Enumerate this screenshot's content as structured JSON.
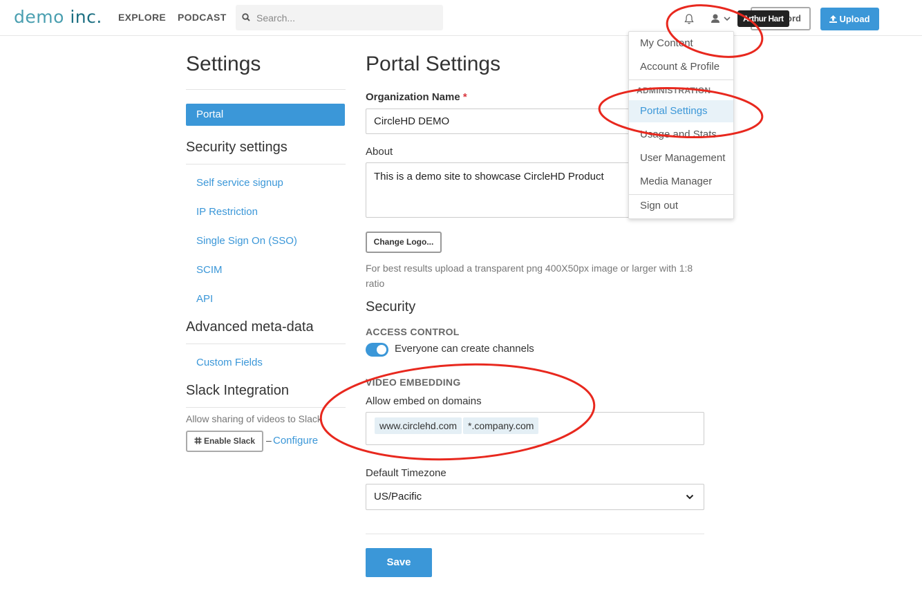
{
  "header": {
    "logo_main": "demo",
    "logo_accent": "inc.",
    "nav": [
      "EXPLORE",
      "PODCAST"
    ],
    "search_placeholder": "Search...",
    "user_tooltip": "Arthur Hart",
    "record_label": "ord",
    "upload_label": "Upload"
  },
  "sidebar": {
    "title": "Settings",
    "active_item": "Portal",
    "security_title": "Security settings",
    "security_links": [
      "Self service signup",
      "IP Restriction",
      "Single Sign On (SSO)",
      "SCIM",
      "API"
    ],
    "meta_title": "Advanced meta-data",
    "meta_links": [
      "Custom Fields"
    ],
    "slack_title": "Slack Integration",
    "slack_desc": "Allow sharing of videos to Slack",
    "enable_slack": "Enable Slack",
    "dash": "–",
    "configure": "Configure"
  },
  "main": {
    "title": "Portal Settings",
    "org_label": "Organization Name",
    "org_required": "*",
    "org_value": "CircleHD DEMO",
    "about_label": "About",
    "about_value": "This is a demo site to showcase CircleHD Product",
    "change_logo": "Change Logo...",
    "logo_hint": "For best results upload a transparent png 400X50px image or larger with 1:8 ratio",
    "security_title": "Security",
    "access_control": "ACCESS CONTROL",
    "toggle_label": "Everyone can create channels",
    "toggle_on": true,
    "video_embedding": "VIDEO EMBEDDING",
    "embed_label": "Allow embed on domains",
    "embed_domains": [
      "www.circlehd.com",
      "*.company.com"
    ],
    "timezone_label": "Default Timezone",
    "timezone_value": "US/Pacific",
    "save_label": "Save"
  },
  "user_menu": {
    "items_top": [
      "My Content",
      "Account & Profile"
    ],
    "admin_header": "ADMINISTRATION",
    "admin_items": [
      "Portal Settings",
      "Usage and Stats",
      "User Management",
      "Media Manager"
    ],
    "active_item": "Portal Settings",
    "sign_out": "Sign out"
  },
  "colors": {
    "accent": "#3b97d8",
    "annotation": "#e8281e",
    "logo": "#4a9fb0"
  }
}
